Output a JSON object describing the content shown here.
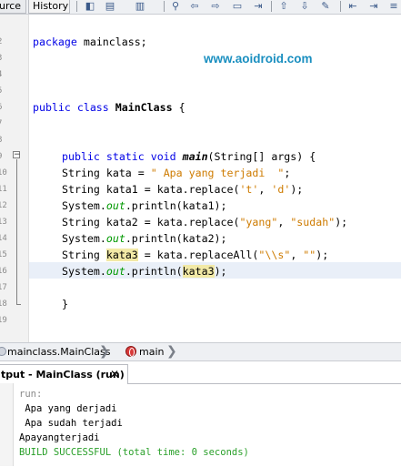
{
  "editor_tabs": {
    "source": "urce",
    "history": "History"
  },
  "toolbar_icons": [
    "back-icon",
    "forward-icon",
    "history-icon",
    "search-icon",
    "prev-icon",
    "next-icon",
    "toggle-icon",
    "step-icon",
    "up-icon",
    "down-icon",
    "bookmark-icon",
    "shift-left-icon",
    "shift-right-icon"
  ],
  "watermark": "www.aoidroid.com",
  "line_numbers": [
    "2",
    "3",
    "4",
    "5",
    "6",
    "7",
    "8",
    "9",
    "10",
    "11",
    "12",
    "13",
    "14",
    "15",
    "16",
    "17",
    "18",
    "19"
  ],
  "code": {
    "package_kw": "package",
    "package_name": " mainclass;",
    "class_public": "public",
    "class_kw": " class ",
    "class_name": "MainClass",
    "class_brace": " {",
    "main_mods": "public static void ",
    "main_name": "main",
    "main_params": "(String[] args) {",
    "l1_a": "String kata = ",
    "l1_str": "\" Apa yang terjadi  \"",
    "l1_b": ";",
    "l2_a": "String kata1 = kata.replace(",
    "l2_s1": "'t'",
    "l2_b": ", ",
    "l2_s2": "'d'",
    "l2_c": ");",
    "l3_a": "System.",
    "l3_out": "out",
    "l3_b": ".println(kata1);",
    "l4_a": "String kata2 = kata.replace(",
    "l4_s1": "\"yang\"",
    "l4_b": ", ",
    "l4_s2": "\"sudah\"",
    "l4_c": ");",
    "l5_a": "System.",
    "l5_out": "out",
    "l5_b": ".println(kata2);",
    "l6_a": "String ",
    "l6_var": "kata3",
    "l6_b": " = kata.replaceAll(",
    "l6_s1": "\"\\\\s\"",
    "l6_c": ", ",
    "l6_s2": "\"\"",
    "l6_d": ");",
    "l7_a": "System.",
    "l7_out": "out",
    "l7_b": ".println(",
    "l7_var": "kata3",
    "l7_c": ");",
    "close_brace": "}"
  },
  "breadcrumb": {
    "class": "mainclass.MainClass",
    "method": "main"
  },
  "output": {
    "tab_label": "tput - MainClass (run)",
    "close": "✕",
    "lines": {
      "run": "run:",
      "l1": " Apa yang derjadi",
      "l2": " Apa sudah terjadi",
      "l3": "Apayangterjadi",
      "build": "BUILD SUCCESSFUL (total time: 0 seconds)"
    }
  },
  "colors": {
    "keyword": "#0000e6",
    "string": "#ce7b00",
    "static_field": "#009900",
    "watermark": "#1a8fc0",
    "build_ok": "#2aa02a",
    "highlight": "#f2e9a6"
  }
}
